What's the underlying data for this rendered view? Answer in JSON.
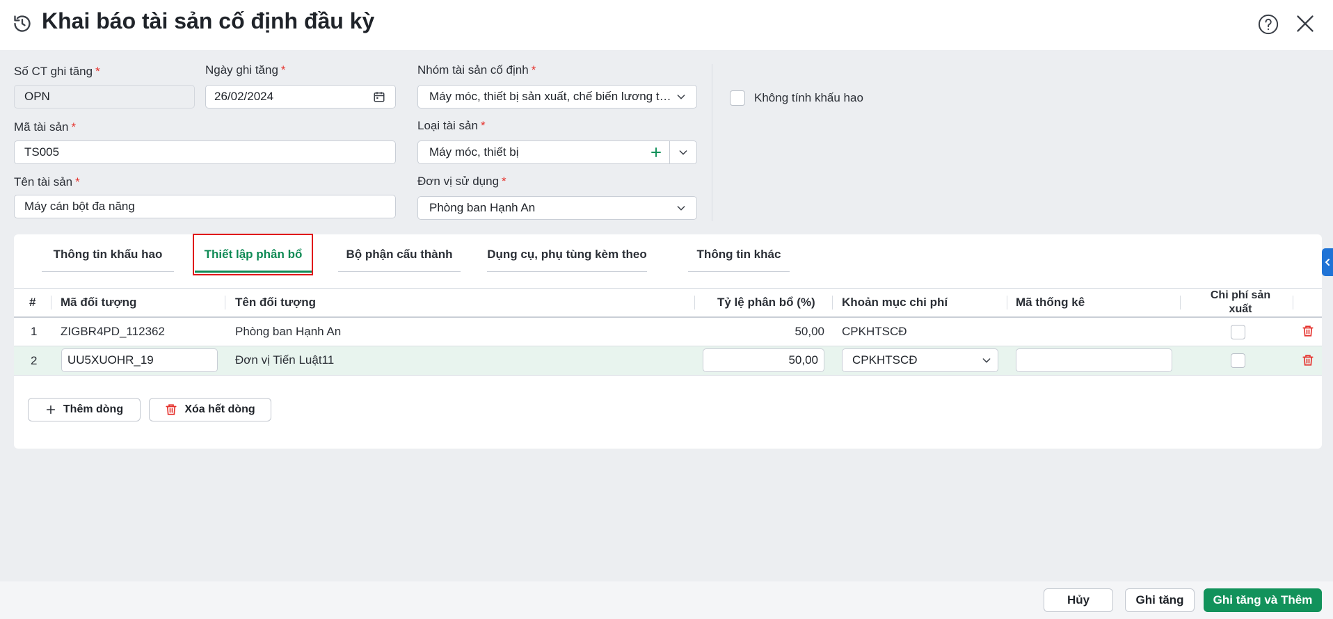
{
  "window": {
    "title": "Khai báo tài sản cố định đầu kỳ"
  },
  "form": {
    "so_ct": {
      "label": "Số CT ghi tăng",
      "value": "OPN"
    },
    "ngay_ghi_tang": {
      "label": "Ngày ghi tăng",
      "value": "26/02/2024"
    },
    "nhom_tai_san": {
      "label": "Nhóm tài sản cố định",
      "value": "Máy móc, thiết bị sản xuất, chế biến lương thực"
    },
    "khong_tinh_khau_hao": {
      "label": "Không tính khấu hao",
      "checked": false
    },
    "ma_tai_san": {
      "label": "Mã tài sản",
      "value": "TS005"
    },
    "loai_tai_san": {
      "label": "Loại tài sản",
      "value": "Máy móc, thiết bị"
    },
    "ten_tai_san": {
      "label": "Tên tài sản",
      "value": "Máy cán bột đa năng"
    },
    "don_vi_su_dung": {
      "label": "Đơn vị sử dụng",
      "value": "Phòng ban Hạnh An"
    },
    "required_mark": "*"
  },
  "tabs": [
    {
      "label": "Thông tin khấu hao",
      "active": false
    },
    {
      "label": "Thiết lập phân bổ",
      "active": true
    },
    {
      "label": "Bộ phận cấu thành",
      "active": false
    },
    {
      "label": "Dụng cụ, phụ tùng kèm theo",
      "active": false
    },
    {
      "label": "Thông tin khác",
      "active": false
    }
  ],
  "table": {
    "columns": {
      "index": "#",
      "ma_doi_tuong": "Mã đối tượng",
      "ten_doi_tuong": "Tên đối tượng",
      "ty_le": "Tỷ lệ phân bổ (%)",
      "khoan_muc": "Khoản mục chi phí",
      "ma_thong_ke": "Mã thống kê",
      "chi_phi_sx_1": "Chi phí sản",
      "chi_phi_sx_2": "xuất"
    },
    "rows": [
      {
        "index": "1",
        "ma_doi_tuong": "ZIGBR4PD_112362",
        "ten_doi_tuong": "Phòng ban Hạnh An",
        "ty_le": "50,00",
        "khoan_muc": "CPKHTSCĐ",
        "ma_thong_ke": "",
        "chi_phi_sx": false
      },
      {
        "index": "2",
        "ma_doi_tuong": "UU5XUOHR_19",
        "ten_doi_tuong": "Đơn vị Tiến Luật11",
        "ty_le": "50,00",
        "khoan_muc": "CPKHTSCĐ",
        "ma_thong_ke": "",
        "chi_phi_sx": false
      }
    ]
  },
  "actions": {
    "add_row": "Thêm dòng",
    "delete_all": "Xóa hết dòng"
  },
  "footer": {
    "cancel": "Hủy",
    "save": "Ghi tăng",
    "save_and_add": "Ghi tăng và Thêm"
  },
  "colors": {
    "accent": "#0f8a55",
    "primary_button": "#12925b",
    "required": "#e5322d",
    "highlight": "#e0161a",
    "delete": "#e5322d",
    "edge_tab": "#1f73d6"
  }
}
